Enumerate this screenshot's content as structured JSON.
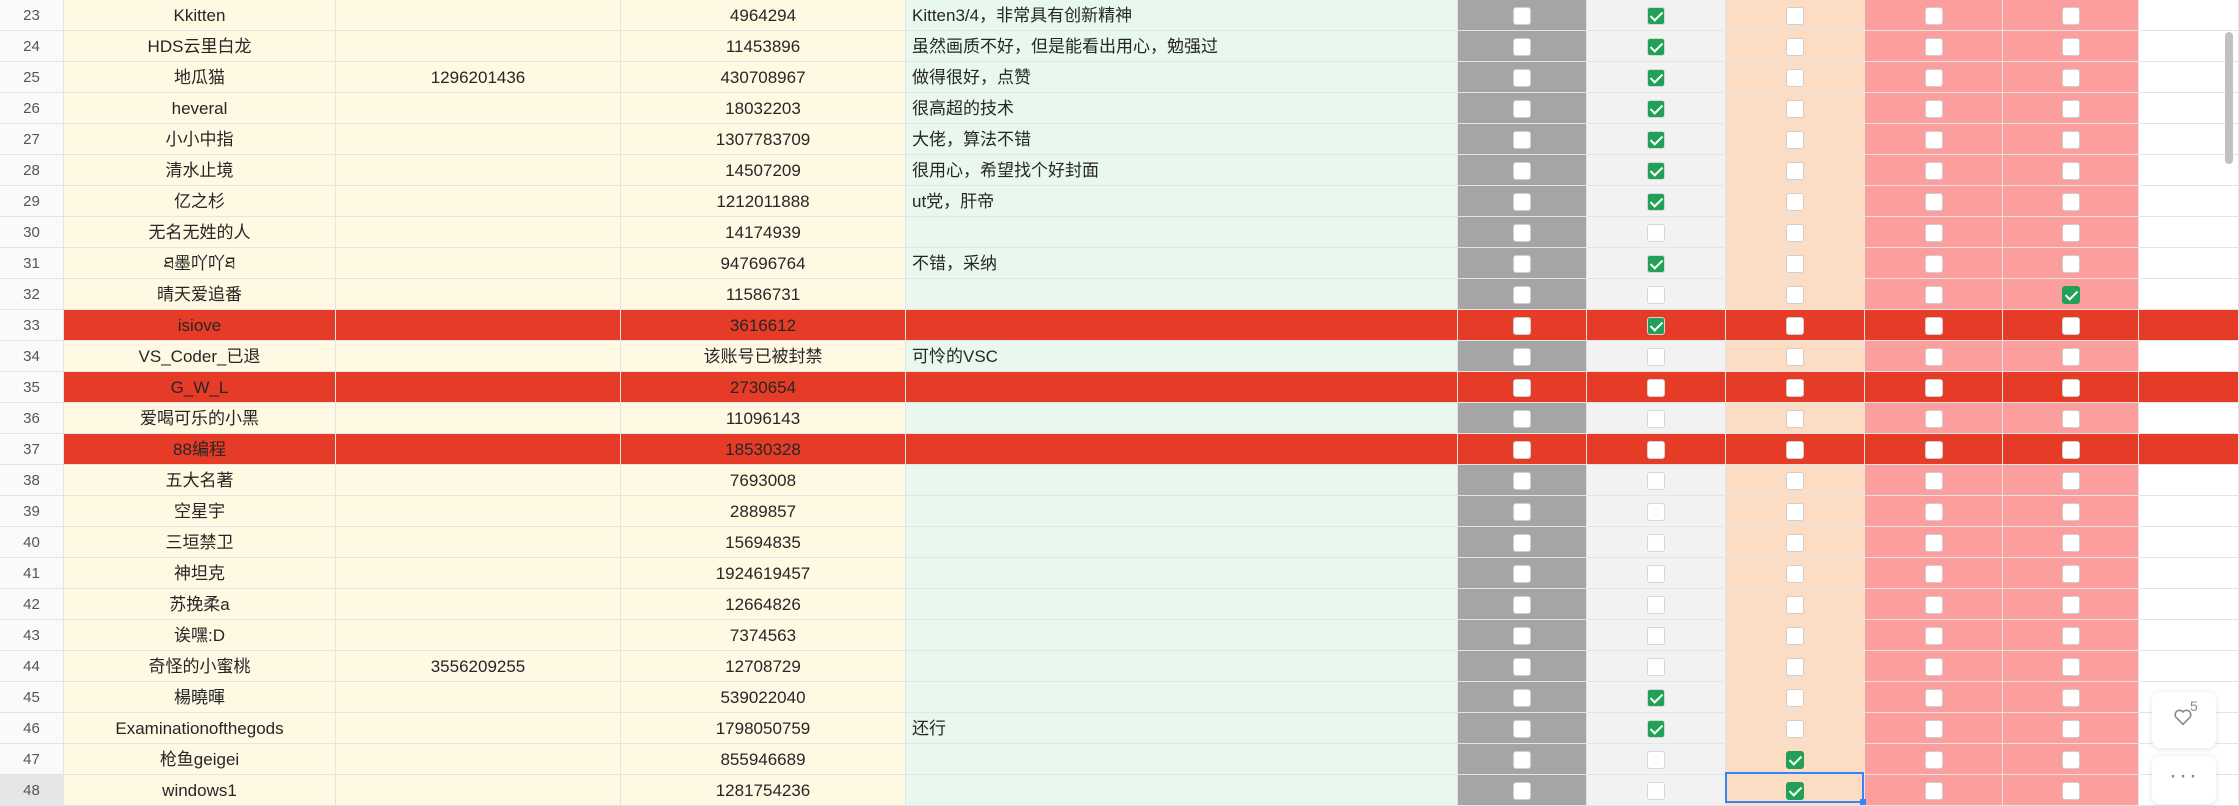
{
  "rows": [
    {
      "n": "23",
      "name": "Kkitten",
      "qq": "",
      "uid": "4964294",
      "comment": "Kitten3/4，非常具有创新精神",
      "checks": [
        false,
        true,
        false,
        false,
        false
      ],
      "red": false
    },
    {
      "n": "24",
      "name": "HDS云里白龙",
      "qq": "",
      "uid": "11453896",
      "comment": "虽然画质不好，但是能看出用心，勉强过",
      "checks": [
        false,
        true,
        false,
        false,
        false
      ],
      "red": false
    },
    {
      "n": "25",
      "name": "地瓜猫",
      "qq": "1296201436",
      "uid": "430708967",
      "comment": "做得很好，点赞",
      "checks": [
        false,
        true,
        false,
        false,
        false
      ],
      "red": false
    },
    {
      "n": "26",
      "name": "heveral",
      "qq": "",
      "uid": "18032203",
      "comment": "很高超的技术",
      "checks": [
        false,
        true,
        false,
        false,
        false
      ],
      "red": false
    },
    {
      "n": "27",
      "name": "小小中指",
      "qq": "",
      "uid": "1307783709",
      "comment": "大佬，算法不错",
      "checks": [
        false,
        true,
        false,
        false,
        false
      ],
      "red": false
    },
    {
      "n": "28",
      "name": "清水止境",
      "qq": "",
      "uid": "14507209",
      "comment": "很用心，希望找个好封面",
      "checks": [
        false,
        true,
        false,
        false,
        false
      ],
      "red": false
    },
    {
      "n": "29",
      "name": "亿之杉",
      "qq": "",
      "uid": "1212011888",
      "comment": "ut党，肝帝",
      "checks": [
        false,
        true,
        false,
        false,
        false
      ],
      "red": false
    },
    {
      "n": "30",
      "name": "无名无姓的人",
      "qq": "",
      "uid": "14174939",
      "comment": "",
      "checks": [
        false,
        false,
        false,
        false,
        false
      ],
      "red": false
    },
    {
      "n": "31",
      "name": "ཐ墨吖吖ཐ",
      "qq": "",
      "uid": "947696764",
      "comment": "不错，采纳",
      "checks": [
        false,
        true,
        false,
        false,
        false
      ],
      "red": false
    },
    {
      "n": "32",
      "name": "晴天爱追番",
      "qq": "",
      "uid": "11586731",
      "comment": "",
      "checks": [
        false,
        false,
        false,
        false,
        true
      ],
      "red": false
    },
    {
      "n": "33",
      "name": "isiove",
      "qq": "",
      "uid": "3616612",
      "comment": "",
      "checks": [
        false,
        true,
        false,
        false,
        false
      ],
      "red": true
    },
    {
      "n": "34",
      "name": "VS_Coder_已退",
      "qq": "",
      "uid": "该账号已被封禁",
      "comment": "可怜的VSC",
      "checks": [
        false,
        false,
        false,
        false,
        false
      ],
      "red": false
    },
    {
      "n": "35",
      "name": "G_W_L",
      "qq": "",
      "uid": "2730654",
      "comment": "",
      "checks": [
        false,
        false,
        false,
        false,
        false
      ],
      "red": true
    },
    {
      "n": "36",
      "name": "爱喝可乐的小黑",
      "qq": "",
      "uid": "11096143",
      "comment": "",
      "checks": [
        false,
        false,
        false,
        false,
        false
      ],
      "red": false
    },
    {
      "n": "37",
      "name": "88编程",
      "qq": "",
      "uid": "18530328",
      "comment": "",
      "checks": [
        false,
        false,
        false,
        false,
        false
      ],
      "red": true
    },
    {
      "n": "38",
      "name": "五大名著",
      "qq": "",
      "uid": "7693008",
      "comment": "",
      "checks": [
        false,
        false,
        false,
        false,
        false
      ],
      "red": false
    },
    {
      "n": "39",
      "name": "空星宇",
      "qq": "",
      "uid": "2889857",
      "comment": "",
      "checks": [
        false,
        false,
        false,
        false,
        false
      ],
      "red": false
    },
    {
      "n": "40",
      "name": "三垣禁卫",
      "qq": "",
      "uid": "15694835",
      "comment": "",
      "checks": [
        false,
        false,
        false,
        false,
        false
      ],
      "red": false
    },
    {
      "n": "41",
      "name": "神坦克",
      "qq": "",
      "uid": "1924619457",
      "comment": "",
      "checks": [
        false,
        false,
        false,
        false,
        false
      ],
      "red": false
    },
    {
      "n": "42",
      "name": "苏挽柔a",
      "qq": "",
      "uid": "12664826",
      "comment": "",
      "checks": [
        false,
        false,
        false,
        false,
        false
      ],
      "red": false
    },
    {
      "n": "43",
      "name": "诶嘿:D",
      "qq": "",
      "uid": "7374563",
      "comment": "",
      "checks": [
        false,
        false,
        false,
        false,
        false
      ],
      "red": false
    },
    {
      "n": "44",
      "name": "奇怪的小蜜桃",
      "qq": "3556209255",
      "uid": "12708729",
      "comment": "",
      "checks": [
        false,
        false,
        false,
        false,
        false
      ],
      "red": false
    },
    {
      "n": "45",
      "name": "楊曉暉",
      "qq": "",
      "uid": "539022040",
      "comment": "",
      "checks": [
        false,
        true,
        false,
        false,
        false
      ],
      "red": false
    },
    {
      "n": "46",
      "name": "Examinationofthegods",
      "qq": "",
      "uid": "1798050759",
      "comment": "还行",
      "checks": [
        false,
        true,
        false,
        false,
        false
      ],
      "red": false
    },
    {
      "n": "47",
      "name": "枪鱼geigei",
      "qq": "",
      "uid": "855946689",
      "comment": "",
      "checks": [
        false,
        false,
        true,
        false,
        false
      ],
      "red": false
    },
    {
      "n": "48",
      "name": "windows1",
      "qq": "",
      "uid": "1281754236",
      "comment": "",
      "checks": [
        false,
        false,
        true,
        false,
        false
      ],
      "red": false
    }
  ],
  "selected_row": "48",
  "like_count": "5",
  "colors": {
    "name_col_bg": "#fff8e3",
    "comment_col_bg": "#e8f8ee",
    "check_col1_bg": "#a5a5a5",
    "check_col2_bg": "#f2f2f2",
    "check_col3_bg": "#fddcc4",
    "check_col4_bg": "#fd9e9e",
    "highlight_row_bg": "#e63b26",
    "checkbox_checked": "#20a157",
    "selection_border": "#3a83f7"
  },
  "icons": {
    "like": "heart-icon",
    "more": "more-dots-icon",
    "checkbox": "checkbox-icon"
  }
}
